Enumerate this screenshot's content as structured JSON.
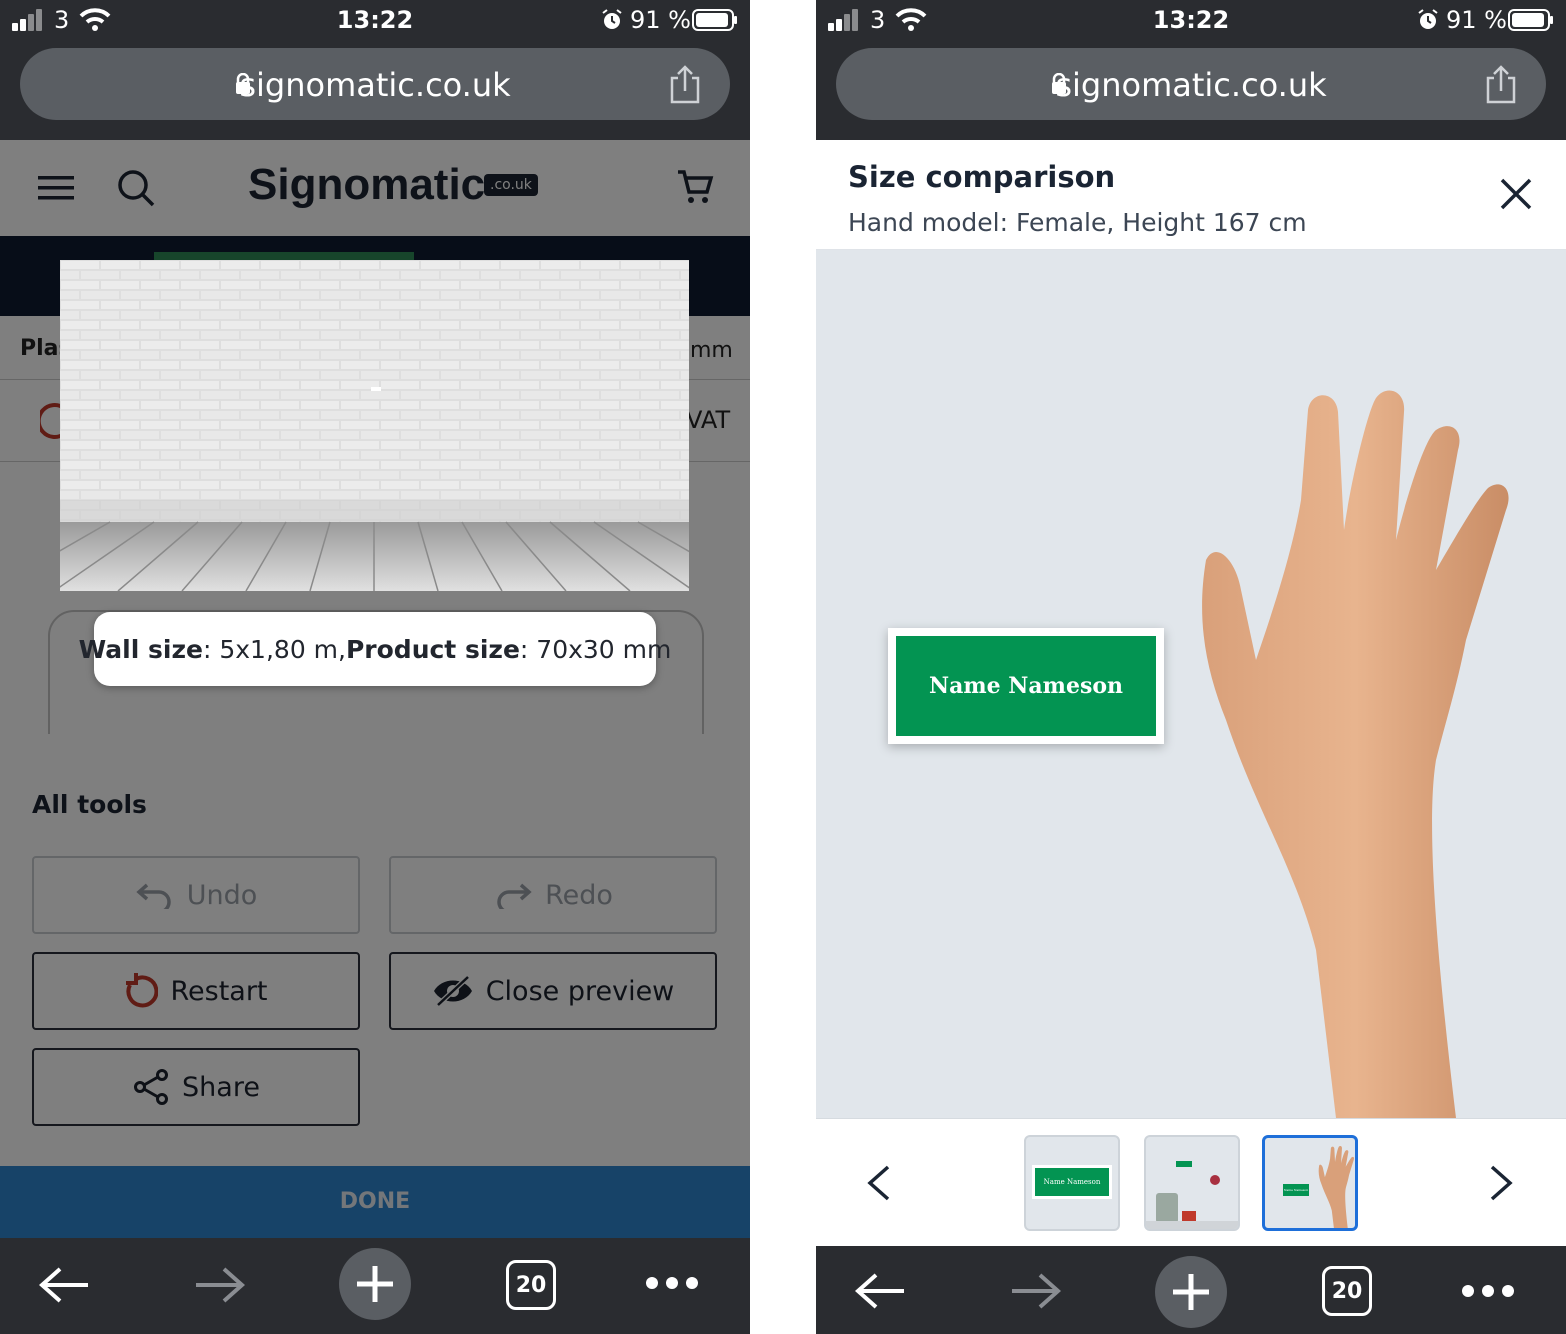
{
  "status_bar": {
    "carrier": "3",
    "time": "13:22",
    "battery": "91 %"
  },
  "browser": {
    "url": "signomatic.co.uk",
    "tab_count": "20"
  },
  "left": {
    "logo_text": "Signomatic",
    "logo_badge": ".co.uk",
    "row1_left": "Plas",
    "row1_right": "mm",
    "row2_right": "VAT",
    "tooltip": {
      "wall_label": "Wall size",
      "wall_value": ": 5x1,80 m, ",
      "product_label": "Product size",
      "product_value": ": 70x30 mm"
    },
    "tools": {
      "heading": "All tools",
      "undo": "Undo",
      "redo": "Redo",
      "restart": "Restart",
      "close_preview": "Close preview",
      "share": "Share"
    },
    "done": "DONE"
  },
  "right": {
    "title": "Size comparison",
    "subtitle": "Hand model: Female, Height 167 cm",
    "sign_text": "Name Nameson",
    "thumb1_text": "Name Nameson",
    "thumb3_text": "Name Nameson"
  },
  "colors": {
    "sign_green": "#039452",
    "done_blue": "#2f86d0",
    "active_thumb": "#1e6fd9",
    "chrome_dark": "#2a2c30"
  },
  "icons": [
    "signal-icon",
    "wifi-icon",
    "alarm-icon",
    "battery-icon",
    "lock-icon",
    "share-icon",
    "menu-icon",
    "search-icon",
    "cart-icon",
    "undo-icon",
    "redo-icon",
    "restart-icon",
    "eye-off-icon",
    "share-nodes-icon",
    "close-icon",
    "chevron-left-icon",
    "chevron-right-icon",
    "back-icon",
    "forward-icon",
    "plus-icon",
    "more-icon"
  ]
}
